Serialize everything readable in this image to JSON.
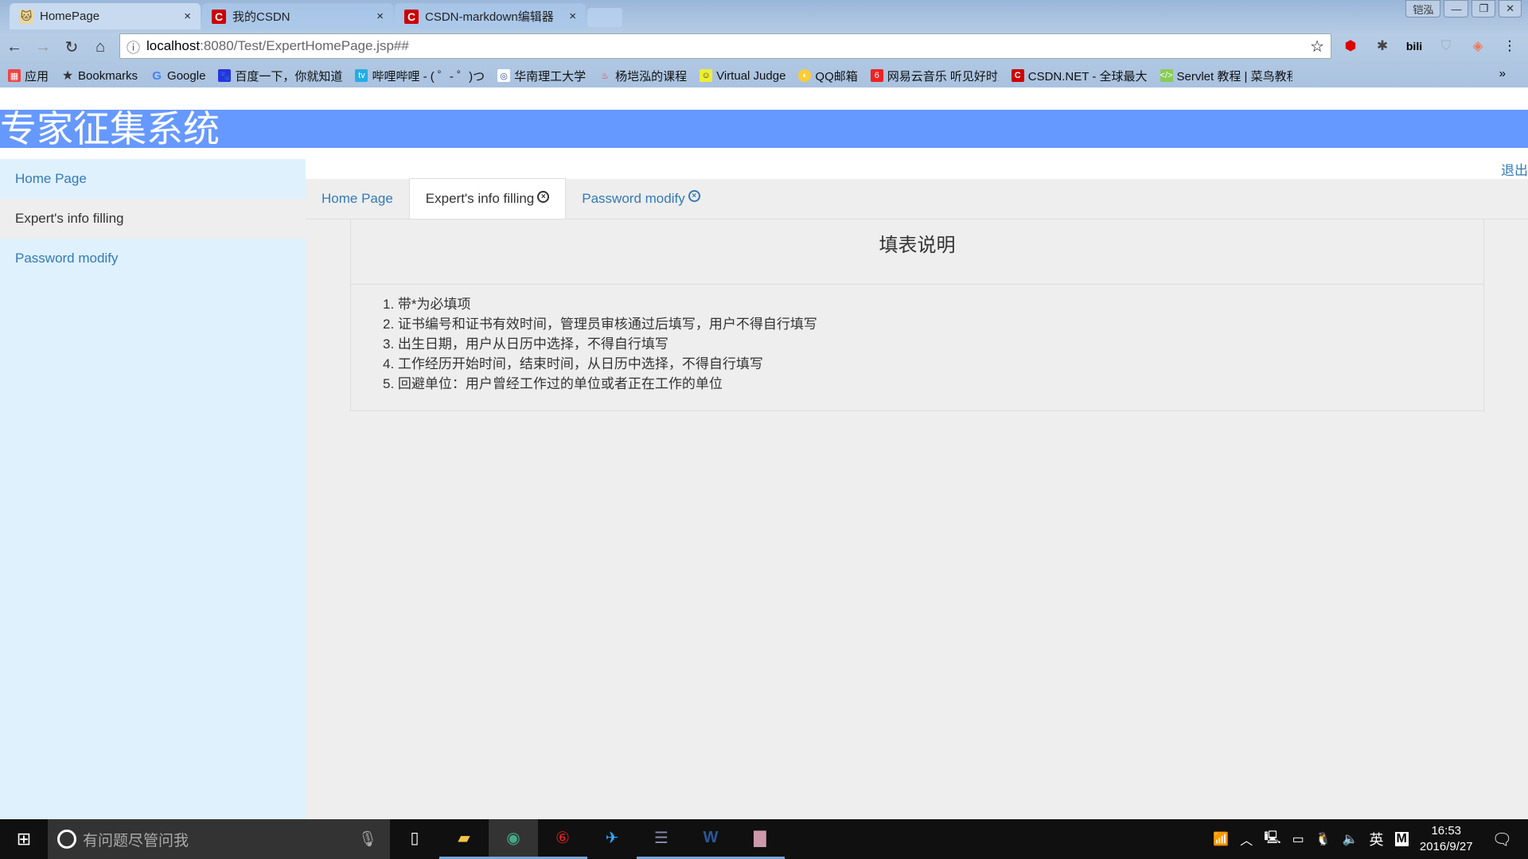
{
  "browser": {
    "tabs": [
      {
        "title": "HomePage",
        "icon": "tomcat-icon",
        "active": true
      },
      {
        "title": "我的CSDN",
        "icon": "csdn-icon"
      },
      {
        "title": "CSDN-markdown编辑器",
        "icon": "csdn-icon"
      }
    ],
    "window_user": "铠泓",
    "url_host": "localhost",
    "url_path": ":8080/Test/ExpertHomePage.jsp##",
    "bookmarks": [
      "应用",
      "Bookmarks",
      "Google",
      "百度一下，你就知道",
      "哔哩哔哩 - ( ゜- ゜)つ",
      "华南理工大学",
      "杨垲泓的课程",
      "Virtual Judge",
      "QQ邮箱",
      "网易云音乐 听见好时光",
      "CSDN.NET - 全球最大",
      "Servlet 教程 | 菜鸟教程"
    ],
    "more": "»"
  },
  "header": {
    "title": "专家征集系统",
    "color": "#6699ff"
  },
  "sidebar": {
    "items": [
      {
        "label": "Home Page"
      },
      {
        "label": "Expert's info filling"
      },
      {
        "label": "Password modify"
      }
    ]
  },
  "logout": "退出",
  "main": {
    "tabs": [
      {
        "label": "Home Page"
      },
      {
        "label": "Expert's info filling",
        "active": true
      },
      {
        "label": "Password modify"
      }
    ],
    "panel": {
      "title": "填表说明",
      "items": [
        "1. 带*为必填项",
        "2. 证书编号和证书有效时间，管理员审核通过后填写，用户不得自行填写",
        "3. 出生日期，用户从日历中选择，不得自行填写",
        "4. 工作经历开始时间，结束时间，从日历中选择，不得自行填写",
        "5. 回避单位：用户曾经工作过的单位或者正在工作的单位"
      ]
    }
  },
  "taskbar": {
    "search_placeholder": "有问题尽管问我",
    "ime": "英",
    "ime2": "M",
    "time": "16:53",
    "date": "2016/9/27"
  }
}
